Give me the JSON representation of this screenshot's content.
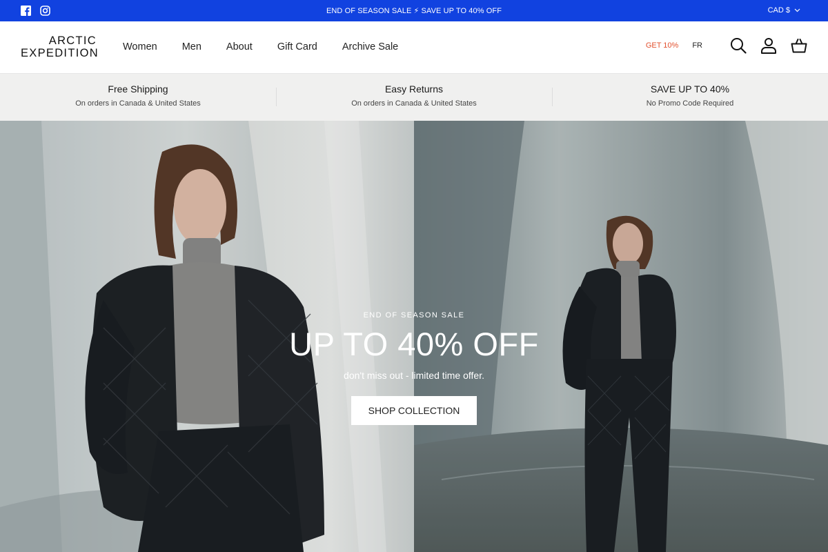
{
  "announcement": {
    "social": [
      "facebook-icon",
      "instagram-icon"
    ],
    "message": "END OF SEASON SALE ⚡ SAVE UP TO 40% OFF",
    "currency": "CAD $"
  },
  "header": {
    "logo_line1": "ARCTIC",
    "logo_line2": "EXPEDITION",
    "nav": [
      "Women",
      "Men",
      "About",
      "Gift Card",
      "Archive Sale"
    ],
    "promo_link": "GET 10%",
    "language": "FR",
    "icons": [
      "search-icon",
      "account-icon",
      "cart-icon"
    ]
  },
  "usp": [
    {
      "title": "Free Shipping",
      "subtitle": "On orders in Canada & United States"
    },
    {
      "title": "Easy Returns",
      "subtitle": "On orders in Canada & United States"
    },
    {
      "title": "SAVE UP TO 40%",
      "subtitle": "No Promo Code Required"
    }
  ],
  "hero": {
    "eyebrow": "END OF SEASON SALE",
    "headline": "UP TO 40% OFF",
    "subline": "don't miss out - limited time offer.",
    "cta": "SHOP COLLECTION"
  },
  "colors": {
    "announcement_bg": "#1142e0",
    "promo_accent": "#e2502e",
    "usp_bg": "#f0f0ef"
  }
}
